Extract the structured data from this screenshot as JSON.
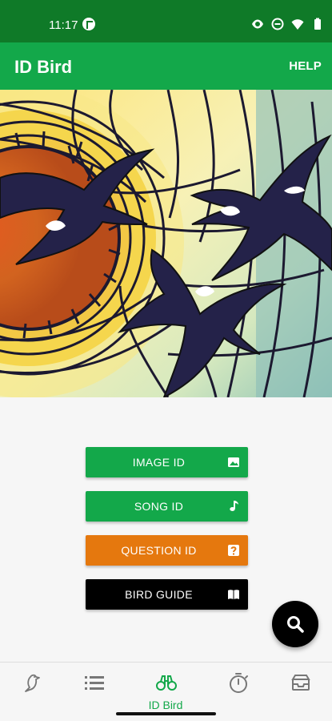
{
  "status_bar": {
    "time": "11:17",
    "icons": [
      "app-notification-icon",
      "eye-icon",
      "do-not-disturb-icon",
      "wifi-icon",
      "battery-icon"
    ]
  },
  "app_bar": {
    "title": "ID Bird",
    "help_label": "HELP",
    "color": "#13a84a"
  },
  "hero": {
    "image": "stained-glass-swallows-illustration"
  },
  "menu": [
    {
      "label": "IMAGE ID",
      "color": "#13a84a",
      "icon": "image-icon"
    },
    {
      "label": "SONG ID",
      "color": "#13a84a",
      "icon": "music-note-icon"
    },
    {
      "label": "QUESTION ID",
      "color": "#e5780e",
      "icon": "question-icon"
    },
    {
      "label": "BIRD GUIDE",
      "color": "#000000",
      "icon": "book-icon"
    }
  ],
  "fab": {
    "icon": "search-icon"
  },
  "bottom_nav": {
    "items": [
      {
        "id": "bird",
        "icon": "bird-icon",
        "label": ""
      },
      {
        "id": "list",
        "icon": "list-icon",
        "label": ""
      },
      {
        "id": "id-bird",
        "icon": "binoculars-icon",
        "label": "ID Bird",
        "active": true
      },
      {
        "id": "timer",
        "icon": "timer-icon",
        "label": ""
      },
      {
        "id": "archive",
        "icon": "archive-icon",
        "label": ""
      }
    ]
  }
}
